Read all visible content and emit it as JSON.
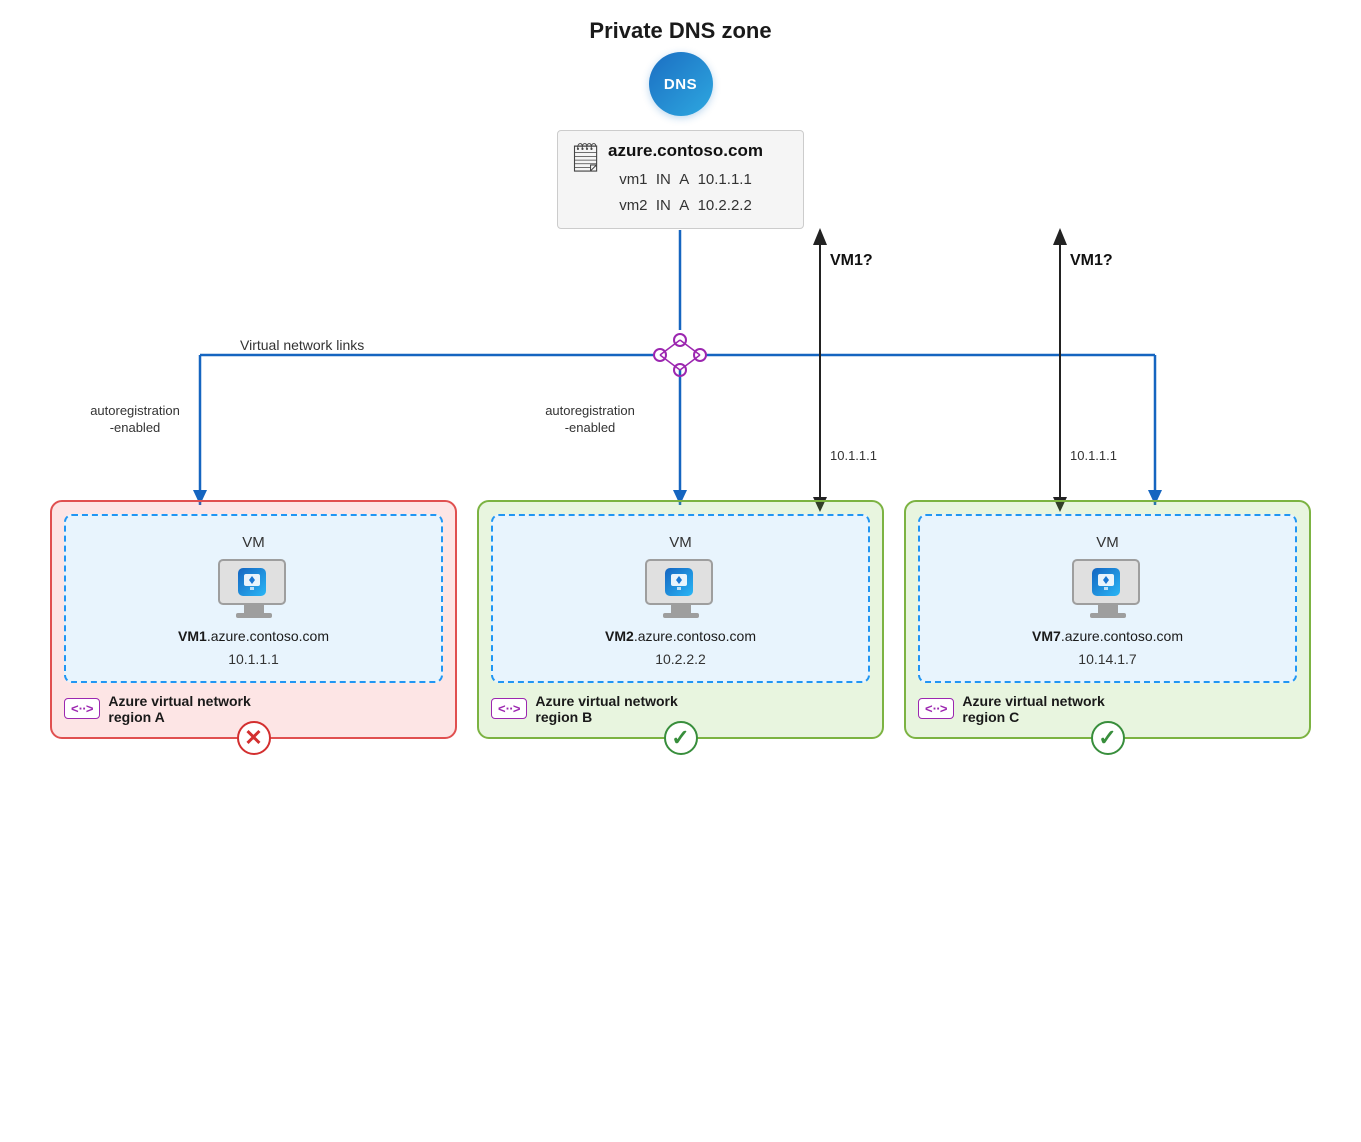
{
  "title": "Private DNS zone",
  "dns": {
    "icon_label": "DNS",
    "domain": "azure.contoso.com",
    "records": [
      {
        "name": "vm1",
        "class": "IN",
        "type": "A",
        "ip": "10.1.1.1"
      },
      {
        "name": "vm2",
        "class": "IN",
        "type": "A",
        "ip": "10.2.2.2"
      }
    ]
  },
  "vnet_links_label": "Virtual network links",
  "vm1_query": "VM1?",
  "ip_response_1": "10.1.1.1",
  "ip_response_2": "10.1.1.1",
  "regions": [
    {
      "id": "A",
      "style": "red",
      "vm_label": "VM",
      "vm_name_bold": "VM1",
      "vm_name_suffix": ".azure.contoso.com",
      "vm_ip": "10.1.1.1",
      "autoregistration": "autoregistration\n-enabled",
      "region_label": "Azure virtual network\nregion A",
      "status": "error",
      "status_symbol": "✕"
    },
    {
      "id": "B",
      "style": "green1",
      "vm_label": "VM",
      "vm_name_bold": "VM2",
      "vm_name_suffix": ".azure.contoso.com",
      "vm_ip": "10.2.2.2",
      "autoregistration": "autoregistration\n-enabled",
      "region_label": "Azure virtual network\nregion B",
      "status": "success",
      "status_symbol": "✓"
    },
    {
      "id": "C",
      "style": "green2",
      "vm_label": "VM",
      "vm_name_bold": "VM7",
      "vm_name_suffix": ".azure.contoso.com",
      "vm_ip": "10.14.1.7",
      "autoregistration": null,
      "region_label": "Azure virtual network\nregion C",
      "status": "success",
      "status_symbol": "✓"
    }
  ]
}
